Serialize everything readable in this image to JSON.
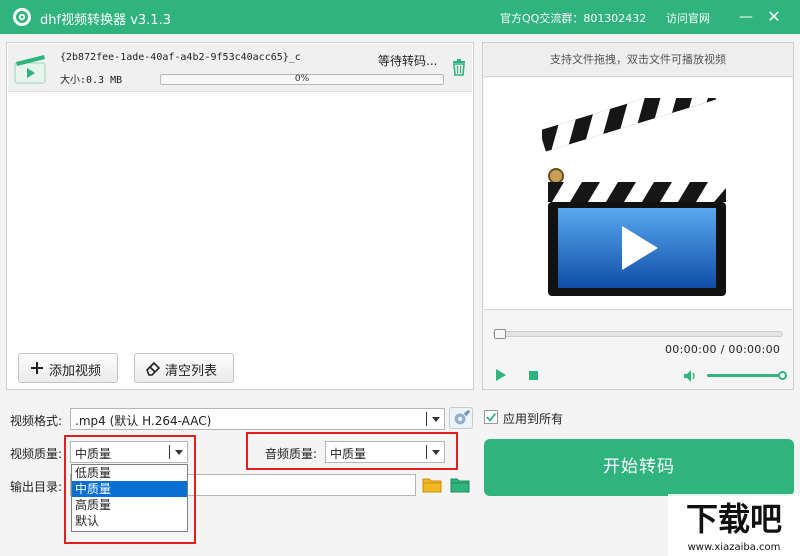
{
  "window": {
    "title": "dhf视频转换器 v3.1.3",
    "qq_group": "官方QQ交流群：801302432",
    "site_link": "访问官网",
    "minimize": "—",
    "close": "✕"
  },
  "file_list": {
    "items": [
      {
        "name": "{2b872fee-1ade-40af-a4b2-9f53c40acc65}_c",
        "status": "等待转码...",
        "size": "大小:0.3 MB",
        "progress_label": "0%",
        "progress": 0
      }
    ],
    "add_button": "添加视频",
    "clear_button": "清空列表"
  },
  "preview": {
    "hint": "支持文件拖拽，双击文件可播放视频",
    "time": "00:00:00 / 00:00:00",
    "seek": 0,
    "volume": 1
  },
  "settings": {
    "format_label": "视频格式:",
    "format_value": ".mp4 (默认 H.264-AAC)",
    "video_quality_label": "视频质量:",
    "video_quality_value": "中质量",
    "video_quality_options": [
      "低质量",
      "中质量",
      "高质量",
      "默认"
    ],
    "video_quality_selected_index": 1,
    "audio_quality_label": "音频质量:",
    "audio_quality_value": "中质量",
    "output_label": "输出目录:",
    "output_value": "",
    "apply_all_label": "应用到所有",
    "apply_all_checked": true,
    "start_button": "开始转码"
  },
  "watermark": {
    "brand": "下载吧",
    "url": "www.xiazaiba.com"
  },
  "colors": {
    "accent": "#2fb47d",
    "highlight": "#e32020",
    "selection": "#0a6fd2"
  }
}
